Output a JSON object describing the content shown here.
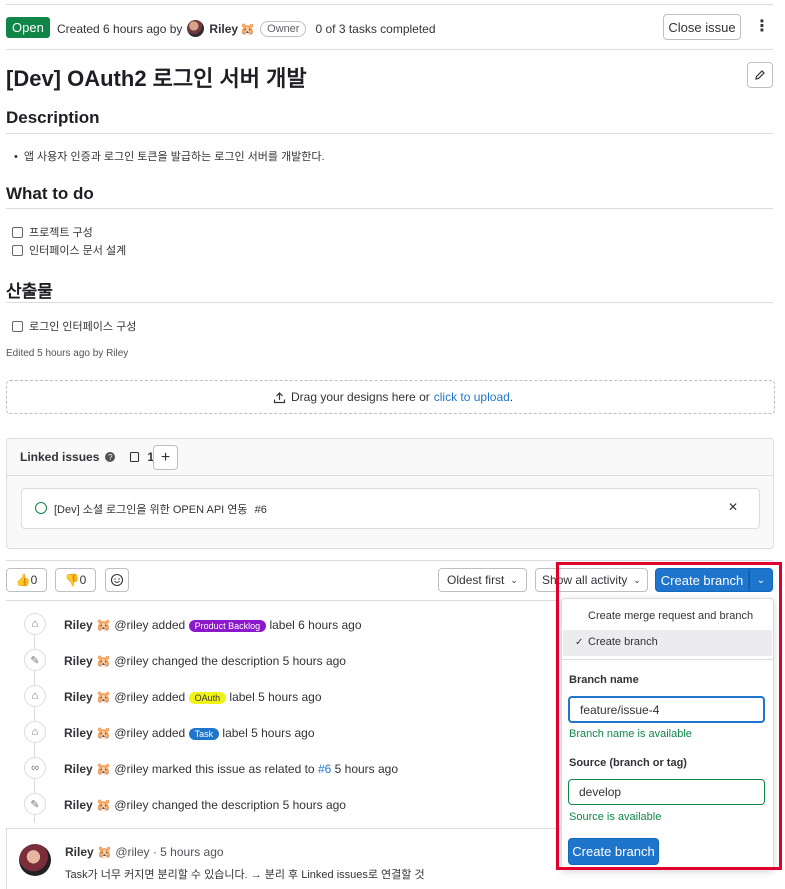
{
  "header": {
    "status": "Open",
    "created_text": "Created 6 hours ago by",
    "author": "Riley",
    "author_emoji": "🐹",
    "owner_badge": "Owner",
    "tasks": "0 of 3 tasks completed",
    "close_button": "Close issue",
    "more_icon": "⋮"
  },
  "issue": {
    "title": "[Dev] OAuth2 로그인 서버 개발",
    "edit_icon": "pencil-icon"
  },
  "description": {
    "heading": "Description",
    "bullet": "앱 사용자 인증과 로그인 토큰을 발급하는 로그인 서버를 개발한다."
  },
  "todo": {
    "heading": "What to do",
    "items": [
      "프로젝트 구성",
      "인터페이스 문서 설계"
    ]
  },
  "deliverables": {
    "heading": "산출물",
    "items": [
      "로그인 인터페이스 구성"
    ]
  },
  "edited": "Edited 5 hours ago by Riley",
  "upload": {
    "text": "Drag your designs here or",
    "link": "click to upload",
    "period": "."
  },
  "linked": {
    "title": "Linked issues",
    "count": "1",
    "add_label": "+",
    "item_title": "[Dev] 소셜 로그인을 위한 OPEN API 연동",
    "item_ref": "#6",
    "close_icon": "✕"
  },
  "reactions": {
    "thumbs_up": "👍",
    "thumbs_up_count": "0",
    "thumbs_down": "👎",
    "thumbs_down_count": "0"
  },
  "activity": {
    "sort": "Oldest first",
    "filter": "Show all activity",
    "create_branch": "Create branch"
  },
  "timeline": [
    {
      "user": "Riley",
      "emoji": "🐹",
      "before": "@riley added",
      "label": "Product Backlog",
      "label_bg": "#8b18c9",
      "label_color": "#ffffff",
      "after": "label 6 hours ago"
    },
    {
      "user": "Riley",
      "emoji": "🐹",
      "before": "@riley changed the description 5 hours ago"
    },
    {
      "user": "Riley",
      "emoji": "🐹",
      "before": "@riley added",
      "label": "OAuth",
      "label_bg": "#f0f316",
      "label_color": "#333238",
      "after": "label 5 hours ago"
    },
    {
      "user": "Riley",
      "emoji": "🐹",
      "before": "@riley added",
      "label": "Task",
      "label_bg": "#1f75cb",
      "label_color": "#ffffff",
      "after": "label 5 hours ago"
    },
    {
      "user": "Riley",
      "emoji": "🐹",
      "before": "@riley marked this issue as related to",
      "ref": "#6",
      "after": "5 hours ago"
    },
    {
      "user": "Riley",
      "emoji": "🐹",
      "before": "@riley changed the description 5 hours ago"
    }
  ],
  "comment": {
    "user": "Riley",
    "emoji": "🐹",
    "meta": "@riley · 5 hours ago",
    "body": "Task가 너무 커지면 분리할 수 있습니다. → 분리 후 Linked issues로 연결할 것"
  },
  "dropdown": {
    "option1": "Create merge request and branch",
    "option2": "Create branch",
    "check": "✓",
    "branch_label": "Branch name",
    "branch_value": "feature/issue-4",
    "branch_ok": "Branch name is available",
    "source_label": "Source (branch or tag)",
    "source_value": "develop",
    "source_ok": "Source is available",
    "submit": "Create branch"
  },
  "colors": {
    "open_green": "#108548",
    "primary_blue": "#1f75cb",
    "highlight_red": "#e0002b"
  }
}
